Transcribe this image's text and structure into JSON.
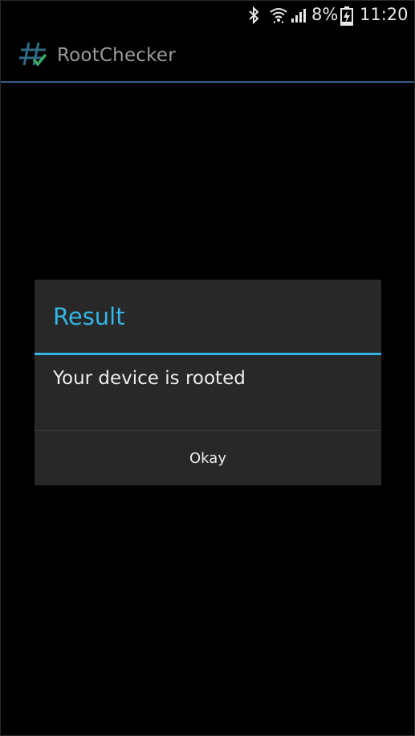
{
  "status_bar": {
    "battery_percent": "8%",
    "time": "11:20",
    "icons": [
      "bluetooth-icon",
      "wifi-icon",
      "signal-icon",
      "battery-charging-icon"
    ]
  },
  "action_bar": {
    "app_icon": "hash-check-icon",
    "title": "RootChecker"
  },
  "dialog": {
    "title": "Result",
    "message": "Your device is rooted",
    "button_label": "Okay"
  },
  "colors": {
    "accent": "#33b5e5",
    "dialog_background": "#282828",
    "screen_background": "#000000",
    "app_icon_hash": "#2f6b86",
    "app_icon_check": "#3aa860"
  }
}
